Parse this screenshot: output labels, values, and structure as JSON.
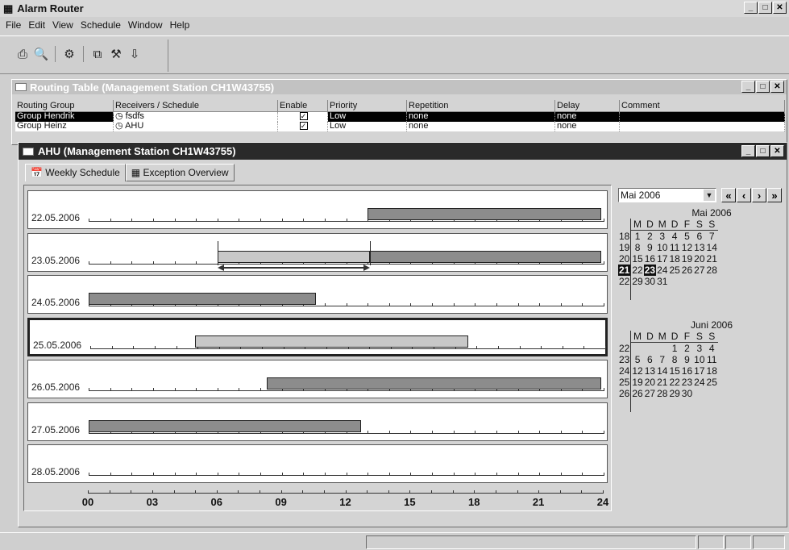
{
  "app": {
    "title": "Alarm Router"
  },
  "menu": [
    "File",
    "Edit",
    "View",
    "Schedule",
    "Window",
    "Help"
  ],
  "toolbar": {
    "icons": [
      "printer-icon",
      "print-preview-icon",
      "properties-icon",
      "copy-icon",
      "tools-icon",
      "export-icon"
    ]
  },
  "routing_window": {
    "title": "Routing Table (Management Station CH1W43755)",
    "columns": [
      "Routing Group",
      "Receivers / Schedule",
      "Enable",
      "Priority",
      "Repetition",
      "Delay",
      "Comment"
    ],
    "rows": [
      {
        "group": "Group Hendrik",
        "receiver": "fsdfs",
        "enabled": true,
        "priority": "Low",
        "repetition": "none",
        "delay": "none",
        "comment": "",
        "selected": true
      },
      {
        "group": "Group Heinz",
        "receiver": "AHU",
        "enabled": true,
        "priority": "Low",
        "repetition": "none",
        "delay": "none",
        "comment": "",
        "selected": false
      }
    ]
  },
  "ahu_window": {
    "title": "AHU (Management Station CH1W43755)",
    "tabs": [
      {
        "label": "Weekly Schedule"
      },
      {
        "label": "Exception Overview"
      }
    ]
  },
  "schedule": {
    "days": [
      {
        "date": "22.05.2006",
        "bars": [
          {
            "start": 13.0,
            "end": 23.9,
            "shade": "dark"
          }
        ]
      },
      {
        "date": "23.05.2006",
        "bars": [
          {
            "start": 6.0,
            "end": 13.1,
            "shade": "light"
          },
          {
            "start": 13.1,
            "end": 23.9,
            "shade": "dark"
          }
        ],
        "markers": [
          6.0,
          13.1
        ]
      },
      {
        "date": "24.05.2006",
        "bars": [
          {
            "start": 0.0,
            "end": 10.6,
            "shade": "dark"
          }
        ]
      },
      {
        "date": "25.05.2006",
        "bars": [
          {
            "start": 4.9,
            "end": 17.6,
            "shade": "light"
          }
        ],
        "selected": true
      },
      {
        "date": "26.05.2006",
        "bars": [
          {
            "start": 8.3,
            "end": 23.9,
            "shade": "dark"
          }
        ]
      },
      {
        "date": "27.05.2006",
        "bars": [
          {
            "start": 0.0,
            "end": 12.7,
            "shade": "dark"
          }
        ]
      },
      {
        "date": "28.05.2006",
        "bars": []
      }
    ],
    "axis_labels": [
      "00",
      "03",
      "06",
      "09",
      "12",
      "15",
      "18",
      "21",
      "24"
    ]
  },
  "calendar": {
    "month_select": "Mai 2006",
    "nav": [
      "«",
      "‹",
      "›",
      "»"
    ],
    "months": [
      {
        "title": "Mai 2006",
        "weekdays": [
          "M",
          "D",
          "M",
          "D",
          "F",
          "S",
          "S"
        ],
        "weeks": [
          {
            "wk": "18",
            "days": [
              "1",
              "2",
              "3",
              "4",
              "5",
              "6",
              "7"
            ]
          },
          {
            "wk": "19",
            "days": [
              "8",
              "9",
              "10",
              "11",
              "12",
              "13",
              "14"
            ]
          },
          {
            "wk": "20",
            "days": [
              "15",
              "16",
              "17",
              "18",
              "19",
              "20",
              "21"
            ]
          },
          {
            "wk": "21",
            "days": [
              "22",
              "23",
              "24",
              "25",
              "26",
              "27",
              "28"
            ]
          },
          {
            "wk": "22",
            "days": [
              "29",
              "30",
              "31",
              "",
              "",
              "",
              ""
            ]
          }
        ],
        "highlight_week": "21",
        "highlight_day": "23"
      },
      {
        "title": "Juni 2006",
        "weekdays": [
          "M",
          "D",
          "M",
          "D",
          "F",
          "S",
          "S"
        ],
        "weeks": [
          {
            "wk": "22",
            "days": [
              "",
              "",
              "",
              "1",
              "2",
              "3",
              "4"
            ]
          },
          {
            "wk": "23",
            "days": [
              "5",
              "6",
              "7",
              "8",
              "9",
              "10",
              "11"
            ]
          },
          {
            "wk": "24",
            "days": [
              "12",
              "13",
              "14",
              "15",
              "16",
              "17",
              "18"
            ]
          },
          {
            "wk": "25",
            "days": [
              "19",
              "20",
              "21",
              "22",
              "23",
              "24",
              "25"
            ]
          },
          {
            "wk": "26",
            "days": [
              "26",
              "27",
              "28",
              "29",
              "30",
              "",
              ""
            ]
          }
        ]
      }
    ]
  },
  "colors": {
    "dark_bar": "#8c8c8c",
    "light_bar": "#c8c8c8",
    "selected_row": "#000000"
  }
}
